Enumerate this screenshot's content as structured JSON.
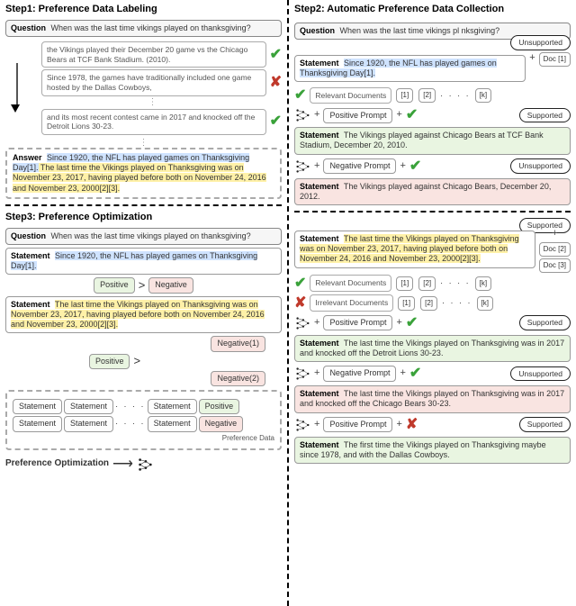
{
  "titles": {
    "step1": "Step1: Preference Data Labeling",
    "step2": "Step2: Automatic Preference Data Collection",
    "step3": "Step3: Preference Optimization"
  },
  "common": {
    "question_label": "Question",
    "statement_label": "Statement",
    "answer_label": "Answer",
    "positive": "Positive",
    "negative": "Negative",
    "negative1": "Negative(1)",
    "negative2": "Negative(2)",
    "positive_prompt": "Positive Prompt",
    "negative_prompt": "Negative Prompt",
    "relevant_docs": "Relevant Documents",
    "irrelevant_docs": "Irrelevant Documents",
    "supported": "Supported",
    "unsupported": "Unsupported",
    "preference_data": "Preference Data",
    "preference_opt": "Preference Optimization",
    "gt": ">",
    "plus": "+",
    "dots": "· · · ·"
  },
  "question": "When was the last time vikings played on thanksgiving?",
  "question_truncated": "When was the last time vikings pl               nksgiving?",
  "step1": {
    "candidates": [
      {
        "text": "the Vikings played their December 20 game vs the Chicago Bears at TCF Bank Stadium. (2010).",
        "mark": "check"
      },
      {
        "text": "Since 1978, the games have traditionally included one game hosted by the Dallas Cowboys,",
        "mark": "cross"
      },
      {
        "text": "and its most recent contest came in 2017 and knocked off the Detroit Lions 30-23.",
        "mark": "check"
      }
    ],
    "answer_parts": {
      "p1": "Since 1920, the NFL has played games on Thanksgiving Day[1].",
      "p2": " The last time the Vikings played on Thanksgiving was on November 23, 2017, having played before both on November 24, 2016 and November 23, 2000[2][3]."
    }
  },
  "step3": {
    "stmt_blue": "Since 1920, the NFL has played games on Thanksgiving Day[1].",
    "stmt_yellow": "The last time the Vikings played on Thanksgiving was on November 23, 2017, having played before both on November 24, 2016 and November 23, 2000[2][3].",
    "chip": "Statement"
  },
  "step2": {
    "top_stmt": "Since 1920, the NFL has played games on Thanksgiving Day[1].",
    "docs": {
      "d1": "Doc [1]",
      "d2": "Doc [2]",
      "d3": "Doc [3]"
    },
    "idx": {
      "i1": "[1]",
      "i2": "[2]",
      "ik": "[k]"
    },
    "pos_result": "The Vikings played against Chicago Bears at TCF Bank Stadium, December 20, 2010.",
    "neg_result": "The Vikings played against Chicago Bears, December 20, 2012.",
    "mid_stmt": "The last time the Vikings played on Thanksgiving was on November 23, 2017, having played before both on November 24, 2016 and November 23, 2000[2][3].",
    "pos_result2": "The last time the Vikings played on Thanksgiving was in 2017 and knocked off the Detroit Lions 30-23.",
    "neg_result2": "The last time the Vikings played on Thanksgiving was in 2017 and knocked off the Chicago Bears 30-23.",
    "pos_result3": "The first time the Vikings played on Thanksgiving maybe since 1978, and with the Dallas Cowboys."
  }
}
